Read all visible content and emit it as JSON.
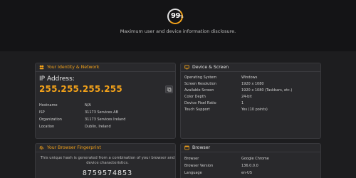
{
  "brand": {
    "logo_main": "99",
    "logo_sub": "%"
  },
  "tagline": "Maximum user and device information disclosure.",
  "identity": {
    "title": "Your Identity & Network",
    "ip_label": "IP Address:",
    "ip_value": "255.255.255.255",
    "rows": [
      {
        "k": "Hostname",
        "v": "N/A"
      },
      {
        "k": "ISP",
        "v": "31173 Services AB"
      },
      {
        "k": "Organization",
        "v": "31173 Services Ireland"
      },
      {
        "k": "Location",
        "v": "Dublin, Ireland"
      }
    ]
  },
  "device": {
    "title": "Device & Screen",
    "rows": [
      {
        "k": "Operating System",
        "v": "Windows"
      },
      {
        "k": "Screen Resolution",
        "v": "1920 x 1080"
      },
      {
        "k": "Available Screen",
        "v": "1920 x 1080 (Taskbars, etc.)"
      },
      {
        "k": "Color Depth",
        "v": "24-bit"
      },
      {
        "k": "Device Pixel Ratio",
        "v": "1"
      },
      {
        "k": "Touch Support",
        "v": "Yes (10 points)"
      }
    ]
  },
  "fingerprint": {
    "title": "Your Browser Fingerprint",
    "desc": "This unique hash is generated from a combination of your browser and device characteristics.",
    "hash": "8759574853"
  },
  "browser": {
    "title": "Browser",
    "rows": [
      {
        "k": "Browser",
        "v": "Google Chrome"
      },
      {
        "k": "Browser Version",
        "v": "136.0.0.0"
      },
      {
        "k": "Language",
        "v": "en-US"
      }
    ]
  },
  "colors": {
    "accent": "#f3a21a",
    "background": "#1d1d1f",
    "card": "#29292c"
  },
  "icons": {
    "identity": "user-network-icon",
    "device": "monitor-icon",
    "fingerprint": "fingerprint-icon",
    "browser": "browser-window-icon",
    "copy": "copy-icon"
  }
}
